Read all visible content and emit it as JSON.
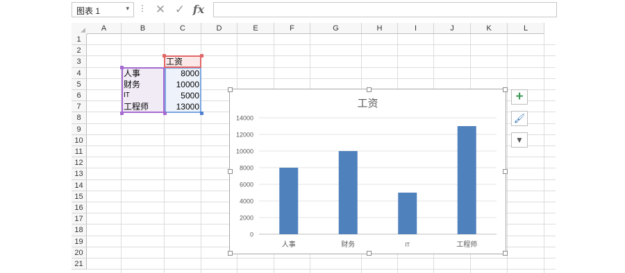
{
  "formula_bar": {
    "name_box": "图表 1",
    "name_box_arrow": "▾",
    "dots": "⋮",
    "cancel": "✕",
    "confirm": "✓",
    "fx": "fx",
    "formula": ""
  },
  "columns": [
    "A",
    "B",
    "C",
    "D",
    "E",
    "F",
    "G",
    "H",
    "I",
    "J",
    "K",
    "L"
  ],
  "rows": [
    "1",
    "2",
    "3",
    "4",
    "5",
    "6",
    "7",
    "8",
    "9",
    "10",
    "11",
    "12",
    "13",
    "14",
    "15",
    "16",
    "17",
    "18",
    "19",
    "20",
    "21"
  ],
  "sheet": {
    "header_label": "工资",
    "table": [
      {
        "dept": "人事",
        "salary": "8000"
      },
      {
        "dept": "财务",
        "salary": "10000"
      },
      {
        "dept": "IT",
        "salary": "5000"
      },
      {
        "dept": "工程师",
        "salary": "13000"
      }
    ]
  },
  "chart_data": {
    "type": "bar",
    "title": "工资",
    "categories": [
      "人事",
      "财务",
      "IT",
      "工程师"
    ],
    "values": [
      8000,
      10000,
      5000,
      13000
    ],
    "ylim": [
      0,
      14000
    ],
    "y_ticks": [
      0,
      2000,
      4000,
      6000,
      8000,
      10000,
      12000,
      14000
    ],
    "bar_color": "#4f81bd",
    "grid": true,
    "legend": "none"
  },
  "side_buttons": {
    "elements": "+",
    "styles": "🖌",
    "filters": "▼"
  }
}
